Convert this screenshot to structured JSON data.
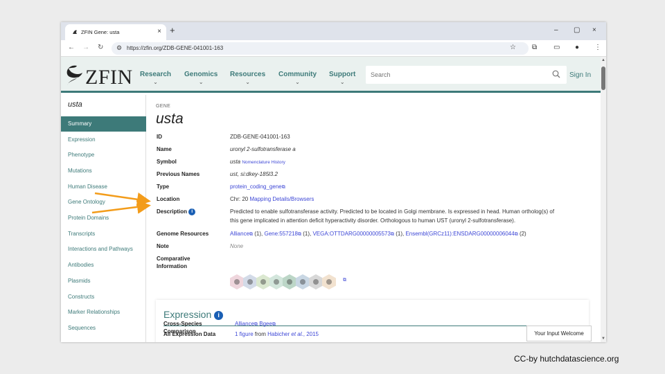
{
  "browser": {
    "tab_title": "ZFIN Gene: usta",
    "new_tab": "+",
    "url": "https://zfin.org/ZDB-GENE-041001-163",
    "window_controls": [
      "–",
      "▢",
      "×"
    ]
  },
  "site": {
    "logo_text": "ZFIN",
    "nav": [
      "Research",
      "Genomics",
      "Resources",
      "Community",
      "Support"
    ],
    "search_placeholder": "Search",
    "sign_in": "Sign In",
    "accent_color": "#3d7a79",
    "link_color": "#3d47d6"
  },
  "sidebar": {
    "gene_name": "usta",
    "items": [
      {
        "label": "Summary",
        "active": true
      },
      {
        "label": "Expression"
      },
      {
        "label": "Phenotype"
      },
      {
        "label": "Mutations"
      },
      {
        "label": "Human Disease"
      },
      {
        "label": "Gene Ontology"
      },
      {
        "label": "Protein Domains"
      },
      {
        "label": "Transcripts"
      },
      {
        "label": "Interactions and Pathways"
      },
      {
        "label": "Antibodies"
      },
      {
        "label": "Plasmids"
      },
      {
        "label": "Constructs"
      },
      {
        "label": "Marker Relationships"
      },
      {
        "label": "Sequences"
      }
    ]
  },
  "gene": {
    "section_label": "GENE",
    "title": "usta",
    "fields": {
      "id": {
        "key": "ID",
        "value": "ZDB-GENE-041001-163"
      },
      "name": {
        "key": "Name",
        "value": "uronyl 2-sulfotransferase a"
      },
      "symbol": {
        "key": "Symbol",
        "value": "usta",
        "link": "Nomenclature History"
      },
      "previous_names": {
        "key": "Previous Names",
        "value": "ust, si:dkey-185l3.2"
      },
      "type": {
        "key": "Type",
        "value": "protein_coding_gene"
      },
      "location": {
        "key": "Location",
        "value": "Chr: 20",
        "link": "Mapping Details/Browsers"
      },
      "description": {
        "key": "Description",
        "line1": "Predicted to enable sulfotransferase activity. Predicted to be located in Golgi membrane. Is expressed in head. Human ortholog(s) of",
        "line2": "this gene implicated in attention deficit hyperactivity disorder. Orthologous to human UST (uronyl 2-sulfotransferase)."
      },
      "genome_resources": {
        "key": "Genome Resources",
        "items": [
          {
            "link": "Alliance",
            "count": "(1),"
          },
          {
            "link": "Gene:557218",
            "count": "(1),"
          },
          {
            "link": "VEGA:OTTDARG00000005573",
            "count": "(1),"
          },
          {
            "link": "Ensembl(GRCz11):ENSDARG00000006044",
            "count": "(2)"
          }
        ]
      },
      "note": {
        "key": "Note",
        "value": "None"
      },
      "comparative": {
        "key_line1": "Comparative",
        "key_line2": "Information"
      }
    },
    "comparative_icons": [
      {
        "name": "fly-icon",
        "color": "#efd6dd"
      },
      {
        "name": "worm-icon",
        "color": "#d3dbe8"
      },
      {
        "name": "plant-icon",
        "color": "#dbe8d0"
      },
      {
        "name": "frog-icon",
        "color": "#d3e6dc"
      },
      {
        "name": "zebrafish-icon",
        "color": "#bcd6c7"
      },
      {
        "name": "fish-icon",
        "color": "#c9d7e4"
      },
      {
        "name": "mouse-icon",
        "color": "#d8d8d8"
      },
      {
        "name": "human-icon",
        "color": "#f2e2cf"
      }
    ]
  },
  "expression": {
    "title": "Expression",
    "all_data_key": "All Expression Data",
    "figure_link": "1 figure",
    "from": "from",
    "author": "Habicher",
    "et_al": "et al.",
    "year": ", 2015",
    "cross_species_line1": "Cross-Species",
    "cross_species_line2": "Comparison",
    "links": [
      "Alliance",
      "Bgee"
    ]
  },
  "feedback": "Your Input Welcome",
  "credit": "CC-by hutchdatascience.org",
  "annotation_color": "#f39c1a"
}
